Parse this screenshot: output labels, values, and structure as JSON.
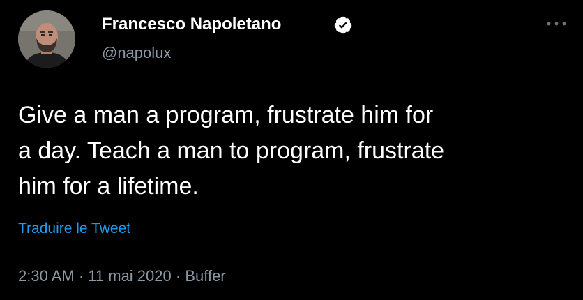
{
  "author": {
    "display_name": "Francesco Napoletano",
    "handle": "@napolux",
    "verified": true
  },
  "tweet": {
    "text": "Give a man a program, frustrate him for\na day. Teach a man to program, frustrate\nhim for a lifetime.",
    "translate_label": "Traduire le Tweet",
    "time": "2:30 AM",
    "date": "11 mai 2020",
    "source": "Buffer",
    "separator": "·"
  },
  "icons": {
    "verified": "verified-badge-icon",
    "more": "more-horizontal-icon"
  },
  "colors": {
    "background": "#000000",
    "primary_text": "#ffffff",
    "secondary_text": "#8b98a5",
    "link": "#1d9bf0"
  }
}
